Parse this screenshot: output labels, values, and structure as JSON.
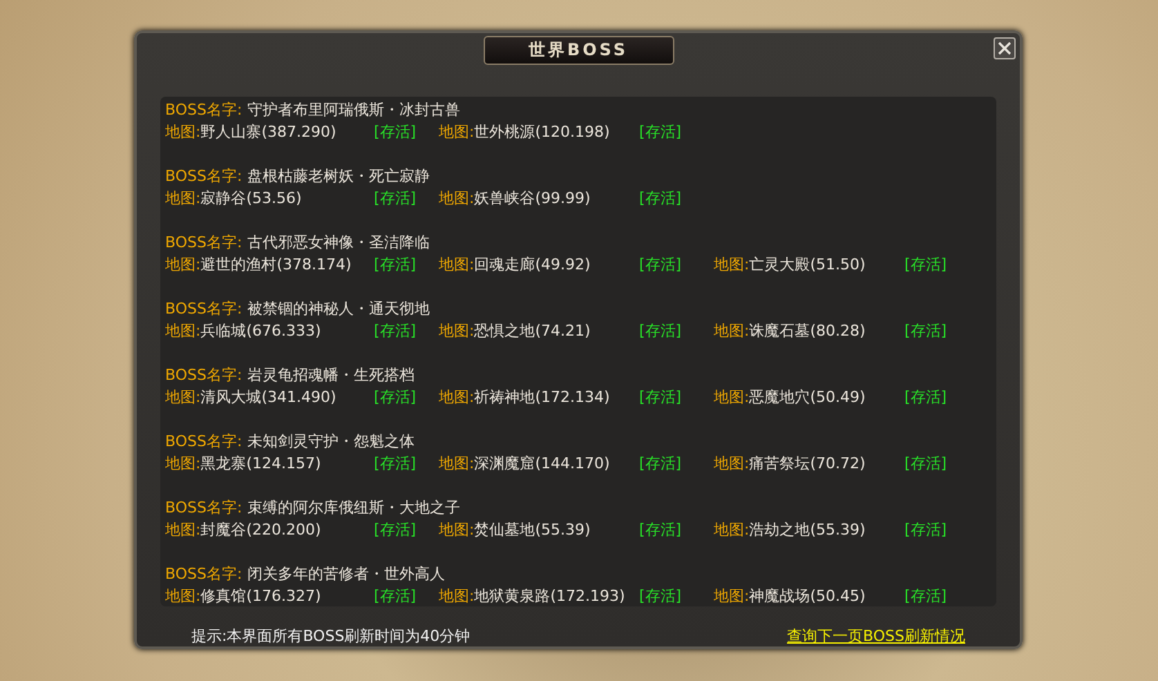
{
  "window": {
    "title": "世界BOSS"
  },
  "bosses": [
    {
      "label": "BOSS名字:",
      "name": "守护者布里阿瑞俄斯・冰封古兽",
      "maps": [
        {
          "label": "地图:",
          "name": "野人山寨(387.290)",
          "status": "[存活]"
        },
        {
          "label": "地图:",
          "name": "世外桃源(120.198)",
          "status": "[存活]"
        }
      ]
    },
    {
      "label": "BOSS名字:",
      "name": "盘根枯藤老树妖・死亡寂静",
      "maps": [
        {
          "label": "地图:",
          "name": "寂静谷(53.56)",
          "status": "[存活]"
        },
        {
          "label": "地图:",
          "name": "妖兽峡谷(99.99)",
          "status": "[存活]"
        }
      ]
    },
    {
      "label": "BOSS名字:",
      "name": "古代邪恶女神像・圣洁降临",
      "maps": [
        {
          "label": "地图:",
          "name": "避世的渔村(378.174)",
          "status": "[存活]"
        },
        {
          "label": "地图:",
          "name": "回魂走廊(49.92)",
          "status": "[存活]"
        },
        {
          "label": "地图:",
          "name": "亡灵大殿(51.50)",
          "status": "[存活]"
        }
      ]
    },
    {
      "label": "BOSS名字:",
      "name": "被禁锢的神秘人・通天彻地",
      "maps": [
        {
          "label": "地图:",
          "name": "兵临城(676.333)",
          "status": "[存活]"
        },
        {
          "label": "地图:",
          "name": "恐惧之地(74.21)",
          "status": "[存活]"
        },
        {
          "label": "地图:",
          "name": "诛魔石墓(80.28)",
          "status": "[存活]"
        }
      ]
    },
    {
      "label": "BOSS名字:",
      "name": "岩灵龟招魂幡・生死搭档",
      "maps": [
        {
          "label": "地图:",
          "name": "清风大城(341.490)",
          "status": "[存活]"
        },
        {
          "label": "地图:",
          "name": "祈祷神地(172.134)",
          "status": "[存活]"
        },
        {
          "label": "地图:",
          "name": "恶魔地穴(50.49)",
          "status": "[存活]"
        }
      ]
    },
    {
      "label": "BOSS名字:",
      "name": "未知剑灵守护・怨魁之体",
      "maps": [
        {
          "label": "地图:",
          "name": "黑龙寨(124.157)",
          "status": "[存活]"
        },
        {
          "label": "地图:",
          "name": "深渊魔窟(144.170)",
          "status": "[存活]"
        },
        {
          "label": "地图:",
          "name": "痛苦祭坛(70.72)",
          "status": "[存活]"
        }
      ]
    },
    {
      "label": "BOSS名字:",
      "name": "束缚的阿尔库俄纽斯・大地之子",
      "maps": [
        {
          "label": "地图:",
          "name": "封魔谷(220.200)",
          "status": "[存活]"
        },
        {
          "label": "地图:",
          "name": "焚仙墓地(55.39)",
          "status": "[存活]"
        },
        {
          "label": "地图:",
          "name": "浩劫之地(55.39)",
          "status": "[存活]"
        }
      ]
    },
    {
      "label": "BOSS名字:",
      "name": "闭关多年的苦修者・世外高人",
      "maps": [
        {
          "label": "地图:",
          "name": "修真馆(176.327)",
          "status": "[存活]"
        },
        {
          "label": "地图:",
          "name": "地狱黄泉路(172.193)",
          "status": "[存活]"
        },
        {
          "label": "地图:",
          "name": "神魔战场(50.45)",
          "status": "[存活]"
        }
      ]
    }
  ],
  "footer": {
    "hint": "提示:本界面所有BOSS刷新时间为40分钟",
    "link": "查询下一页BOSS刷新情况"
  }
}
